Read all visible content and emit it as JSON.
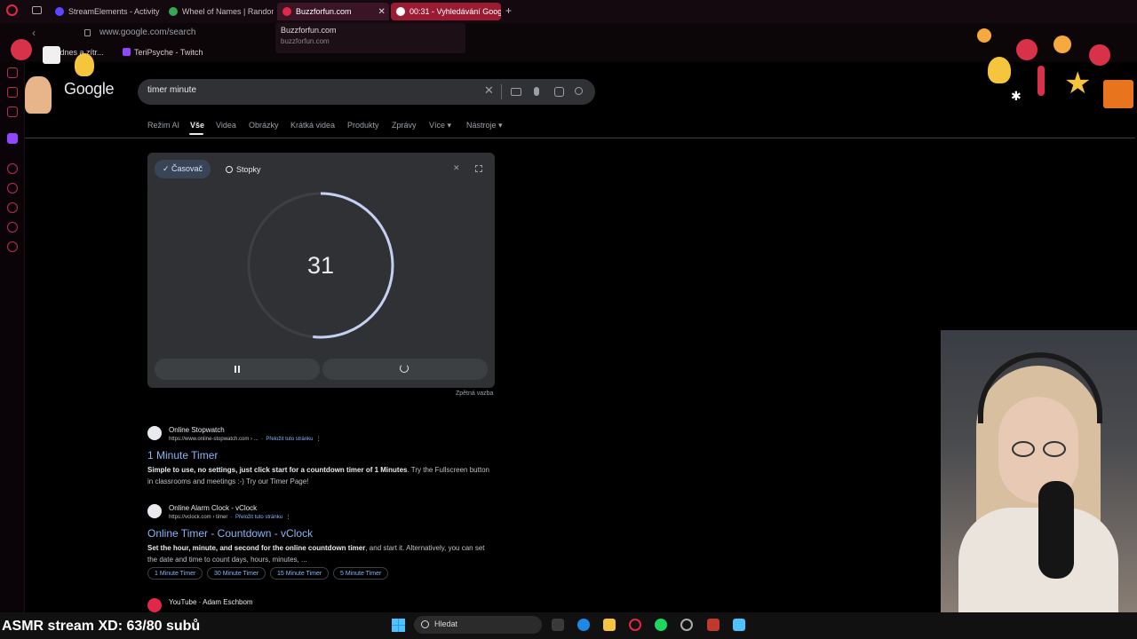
{
  "browser": {
    "tabs": [
      {
        "label": "StreamElements - Activity",
        "color": "#5b47ff"
      },
      {
        "label": "Wheel of Names | Random",
        "color": "#34a853"
      },
      {
        "label": "Buzzforfun.com",
        "color": "#e0294a"
      },
      {
        "label": "00:31 - Vyhledávání Goog",
        "color": "#ffffff"
      }
    ],
    "new_tab": "+",
    "address": "www.google.com/search",
    "bookmarks": [
      "a dnes a zítr...",
      "TeriPsyche - Twitch"
    ],
    "tooltip": {
      "title": "Buzzforfun.com",
      "url": "buzzforfun.com"
    }
  },
  "google": {
    "logo": "Google",
    "query": "timer minute",
    "tabs": [
      "Režim AI",
      "Vše",
      "Videa",
      "Obrázky",
      "Krátká videa",
      "Produkty",
      "Zprávy",
      "Více ▾",
      "Nástroje ▾"
    ],
    "selected_tab": "Vše"
  },
  "timer": {
    "tab_timer": "✓ Časovač",
    "tab_stopwatch": "Stopky",
    "value": "31",
    "progress_remaining": 0.517,
    "feedback": "Zpětná vazba",
    "ring_color": "#c6d0f5"
  },
  "results": [
    {
      "site": "Online Stopwatch",
      "cite": "https://www.online-stopwatch.com › ...",
      "translate": "Přeložit tuto stránku",
      "title": "1 Minute Timer",
      "snippet_bold": "Simple to use, no settings, just click start for a countdown timer of 1 Minutes",
      "snippet_rest": ". Try the Fullscreen button in classrooms and meetings :-) Try our Timer Page!"
    },
    {
      "site": "Online Alarm Clock - vClock",
      "cite": "https://vclock.com › timer",
      "translate": "Přeložit tuto stránku",
      "title": "Online Timer - Countdown - vClock",
      "snippet_bold": "Set the hour, minute, and second for the online countdown timer",
      "snippet_rest": ", and start it. Alternatively, you can set the date and time to count days, hours, minutes, ...",
      "chips": [
        "1 Minute Timer",
        "30 Minute Timer",
        "15 Minute Timer",
        "5 Minute Timer"
      ]
    },
    {
      "site": "YouTube · Adam Eschbom"
    }
  ],
  "overlay": {
    "stream_label": "ASMR stream XD: 63/80 subů"
  },
  "taskbar": {
    "search_placeholder": "Hledat"
  },
  "colors": {
    "link": "#8ab4f8",
    "accent": "#e0294a"
  }
}
